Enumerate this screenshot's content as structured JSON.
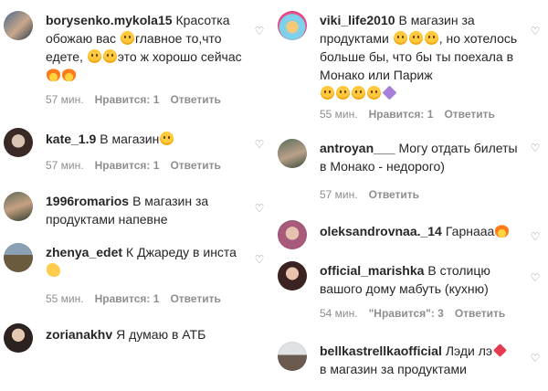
{
  "left_comments": [
    {
      "username": "borysenko.mykola15",
      "text_parts": [
        "Красотка обожаю вас",
        "главное то,что едете",
        "",
        "это ж хорошо сейчас"
      ],
      "time": "57 мин.",
      "likes": "Нравится: 1",
      "reply": "Ответить"
    },
    {
      "username": "kate_1.9",
      "text": "В магазин",
      "time": "57 мин.",
      "likes": "Нравится: 1",
      "reply": "Ответить"
    },
    {
      "username": "1996romarios",
      "text": "В магазин за продуктами напевне"
    },
    {
      "username": "zhenya_edet",
      "text": "К Джареду в инста",
      "time": "55 мин.",
      "likes": "Нравится: 1",
      "reply": "Ответить"
    },
    {
      "username": "zorianakhv",
      "text": "Я думаю в АТБ"
    }
  ],
  "right_comments": [
    {
      "username": "viki_life2010",
      "text_a": "В магазин за продуктами",
      "text_b": ", но хотелось больше бы, что бы ты поехала в Монако или Париж",
      "time": "55 мин.",
      "likes": "Нравится: 1",
      "reply": "Ответить"
    },
    {
      "username": "antroyan___",
      "text": "Могу отдать билеты в Монако - недорого)",
      "time": "57 мин.",
      "reply": "Ответить"
    },
    {
      "username": "oleksandrovnaa._14",
      "text": "Гарнааа"
    },
    {
      "username": "official_marishka",
      "text": "В столицю вашого дому мабуть (кухню)",
      "time": "54 мин.",
      "likes": "\"Нравится\": 3",
      "reply": "Ответить"
    },
    {
      "username": "bellkastrellkaofficial",
      "text_a": "Лэди лэ",
      "text_b": "в магазин за продуктами"
    }
  ],
  "icons": {
    "like": "heart-outline-icon"
  },
  "colors": {
    "text": "#262626",
    "meta": "#8e8e8e"
  }
}
